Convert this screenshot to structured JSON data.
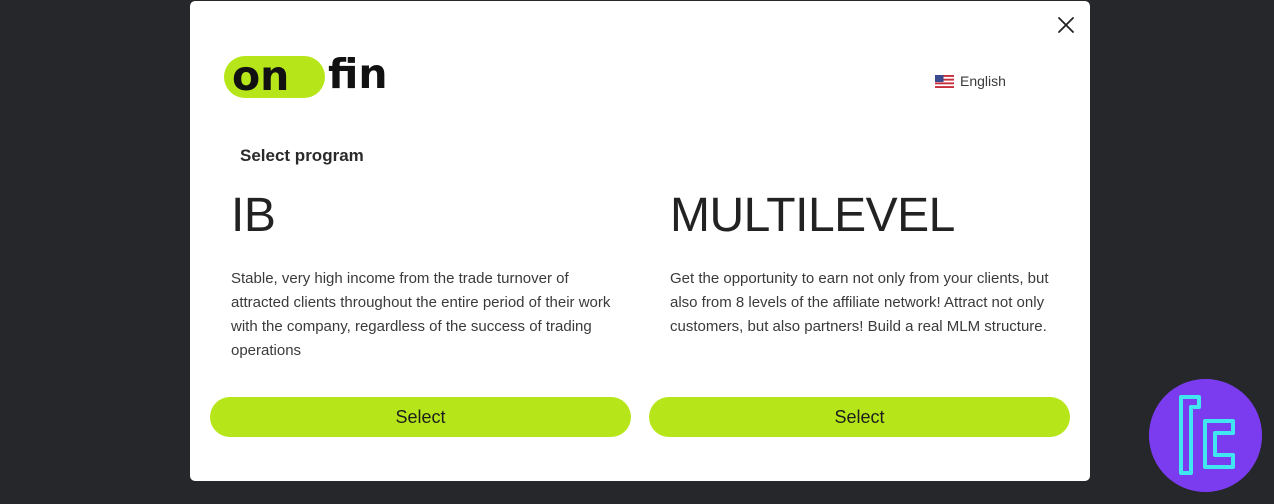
{
  "modal": {
    "language": {
      "label": "English",
      "flag_icon": "us-flag-icon"
    },
    "close_icon": "close-icon",
    "section_title": "Select program",
    "programs": [
      {
        "name": "IB",
        "description": "Stable, very high income from the trade turnover of attracted clients throughout the entire period of their work with the company, regardless of the success of trading operations",
        "button_label": "Select"
      },
      {
        "name": "MULTILEVEL",
        "description": "Get the opportunity to earn not only from your clients, but also from 8 levels of the affiliate network! Attract not only customers, but also partners! Build a real MLM structure.",
        "button_label": "Select"
      }
    ]
  },
  "colors": {
    "accent": "#b6e619",
    "page_background": "#26272b",
    "modal_background": "#ffffff",
    "watermark": "#7b3cf0"
  }
}
